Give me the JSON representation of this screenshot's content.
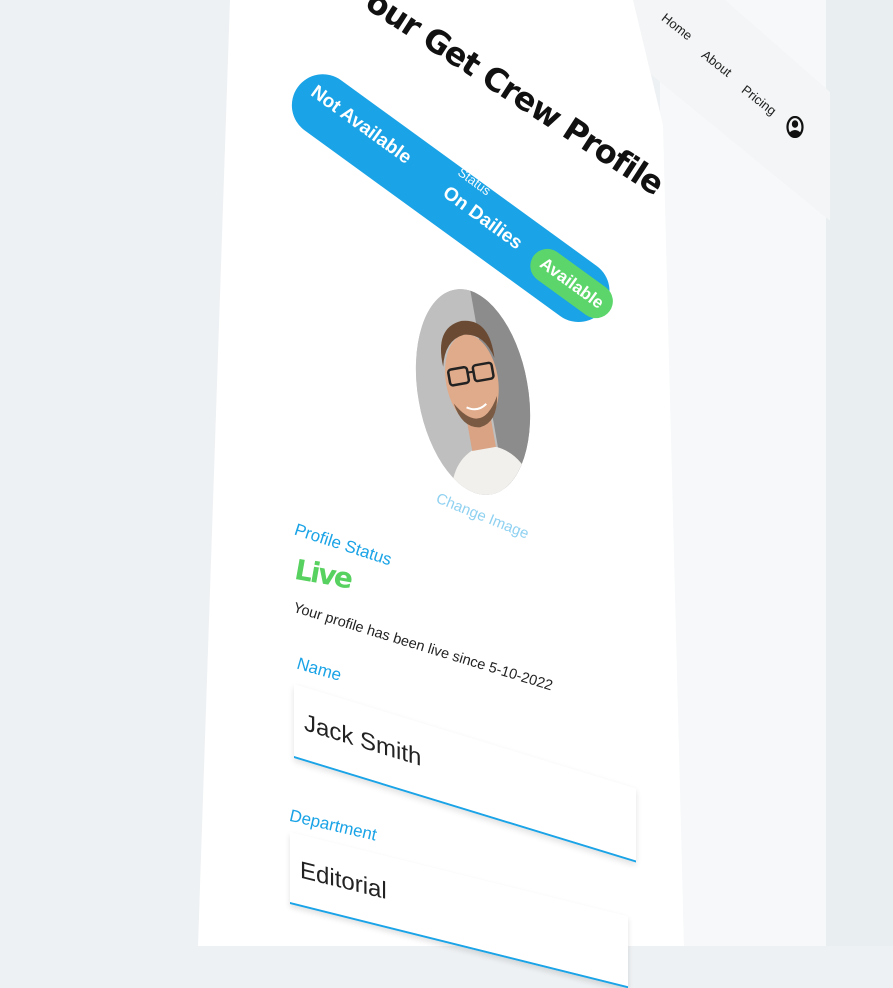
{
  "header": {
    "title": "our Get Crew Profile",
    "nav": [
      "Home",
      "About",
      "Pricing"
    ],
    "user_icon": "user-circle-icon"
  },
  "status_toggle": {
    "label": "Status",
    "options": [
      "Not Available",
      "On Dailies",
      "Available"
    ],
    "selected": "Available"
  },
  "avatar": {
    "change_label": "Change Image"
  },
  "profile_status": {
    "label": "Profile Status",
    "value": "Live",
    "since_text": "Your profile has been live since 5-10-2022"
  },
  "fields": {
    "name": {
      "label": "Name",
      "value": "Jack Smith"
    },
    "department": {
      "label": "Department",
      "value": "Editorial"
    }
  },
  "colors": {
    "accent": "#1aa3e6",
    "live": "#57d15f",
    "available": "#5cd66a"
  }
}
